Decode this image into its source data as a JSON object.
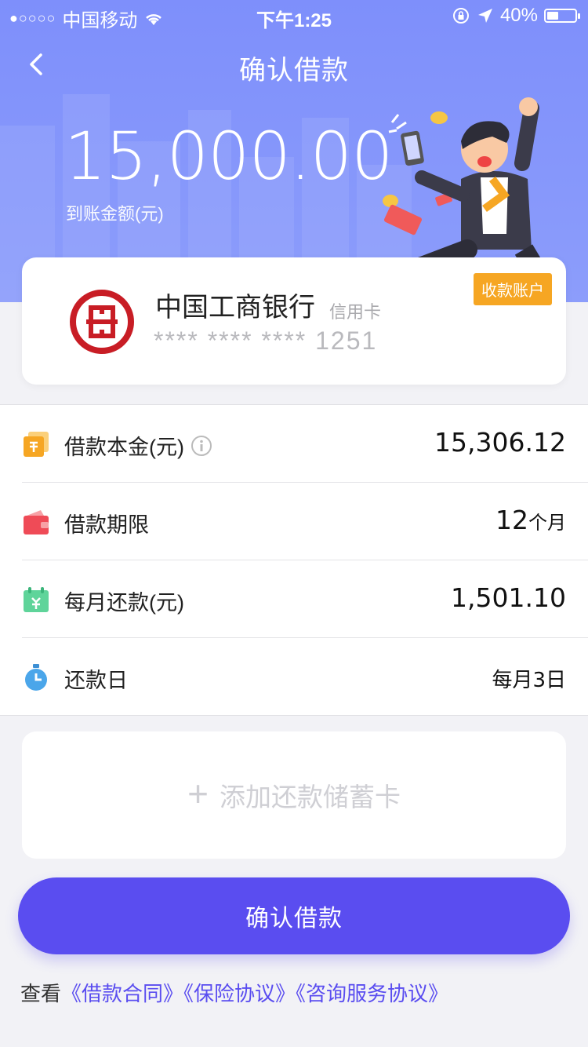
{
  "status_bar": {
    "carrier": "中国移动",
    "time": "下午1:25",
    "battery": "40%",
    "signal_icon": "signal-dots-icon",
    "wifi_icon": "wifi-icon"
  },
  "header": {
    "title": "确认借款",
    "amount": "15,000.00",
    "amount_label": "到账金额(元)",
    "background_color": "#8293fb"
  },
  "bank_card": {
    "bank_name": "中国工商银行",
    "card_type": "信用卡",
    "card_number": "**** **** **** 1251",
    "badge": "收款账户",
    "badge_color": "#f6a623",
    "logo_icon": "icbc-logo-icon"
  },
  "details": [
    {
      "icon": "coin-stack-icon",
      "label": "借款本金(元)",
      "value": "15,306.12",
      "unit": "",
      "has_info": true
    },
    {
      "icon": "wallet-icon",
      "label": "借款期限",
      "value": "12",
      "unit": "个月",
      "has_info": false
    },
    {
      "icon": "calendar-icon",
      "label": "每月还款(元)",
      "value": "1,501.10",
      "unit": "",
      "has_info": false
    },
    {
      "icon": "stopwatch-icon",
      "label": "还款日",
      "value": "每月3日",
      "unit": "",
      "has_info": false
    }
  ],
  "add_card": {
    "label": "添加还款储蓄卡"
  },
  "confirm_button": {
    "label": "确认借款",
    "color": "#5a4df0"
  },
  "agreements": {
    "prefix": "查看",
    "links": [
      "《借款合同》",
      "《保险协议》",
      "《咨询服务协议》"
    ]
  }
}
